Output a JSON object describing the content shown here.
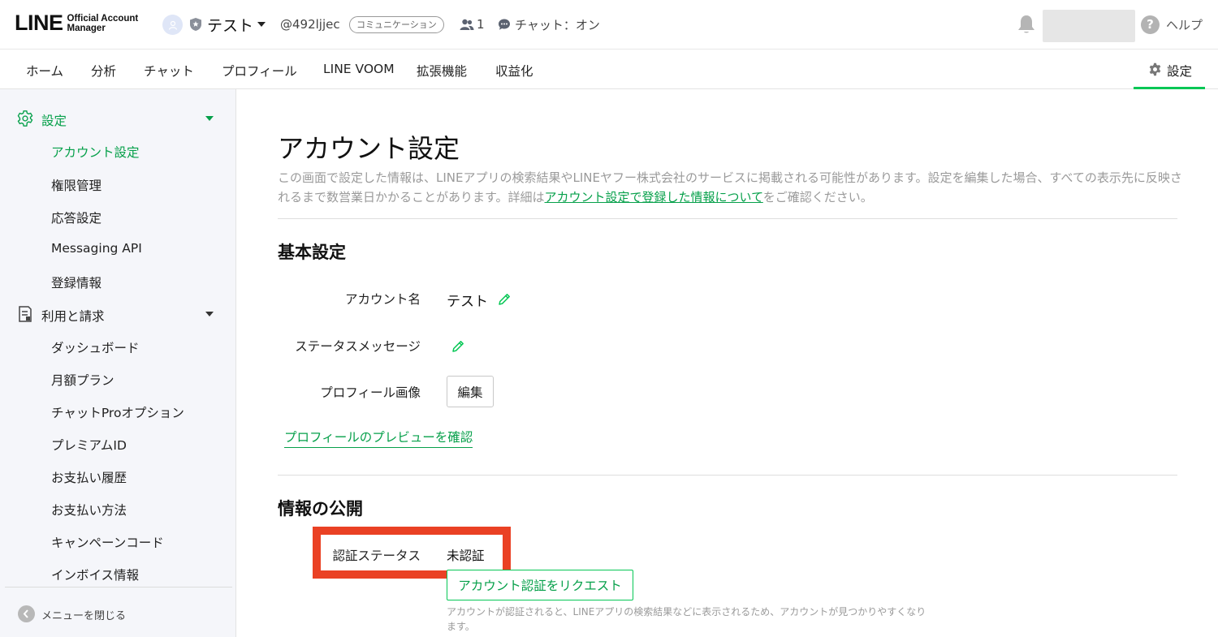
{
  "header": {
    "logo_main": "LINE",
    "logo_sub_1": "Official Account",
    "logo_sub_2": "Manager",
    "account_name": "テスト",
    "account_id": "@492ljjec",
    "plan_badge": "コミュニケーション",
    "friends_count": "1",
    "chat_status": "チャット：オン",
    "help_label": "ヘルプ"
  },
  "nav": {
    "items": [
      "ホーム",
      "分析",
      "チャット",
      "プロフィール",
      "LINE VOOM",
      "拡張機能",
      "収益化"
    ],
    "settings_label": "設定"
  },
  "sidebar": {
    "section1": "設定",
    "section1_items": [
      "アカウント設定",
      "権限管理",
      "応答設定",
      "Messaging API",
      "登録情報"
    ],
    "section2": "利用と請求",
    "section2_items": [
      "ダッシュボード",
      "月額プラン",
      "チャットProオプション",
      "プレミアムID",
      "お支払い履歴",
      "お支払い方法",
      "キャンペーンコード",
      "インボイス情報"
    ],
    "collapse_label": "メニューを閉じる"
  },
  "main": {
    "title": "アカウント設定",
    "desc_part1": "この画面で設定した情報は、LINEアプリの検索結果やLINEヤフー株式会社のサービスに掲載される可能性があります。設定を編集した場合、すべての表示先に反映されるまで数営業日かかることがあります。詳細は",
    "desc_link": "アカウント設定で登録した情報について",
    "desc_part2": "をご確認ください。",
    "basic_title": "基本設定",
    "account_name_label": "アカウント名",
    "account_name_value": "テスト",
    "status_label": "ステータスメッセージ",
    "profile_image_label": "プロフィール画像",
    "edit_button": "編集",
    "preview_link": "プロフィールのプレビューを確認",
    "public_title": "情報の公開",
    "auth_label": "認証ステータス",
    "auth_value": "未認証",
    "request_button": "アカウント認証をリクエスト",
    "note": "アカウントが認証されると、LINEアプリの検索結果などに表示されるため、アカウントが見つかりやすくなります。"
  },
  "colors": {
    "accent": "#06c755",
    "accent_text": "#06a04a",
    "highlight": "#ea4124"
  }
}
